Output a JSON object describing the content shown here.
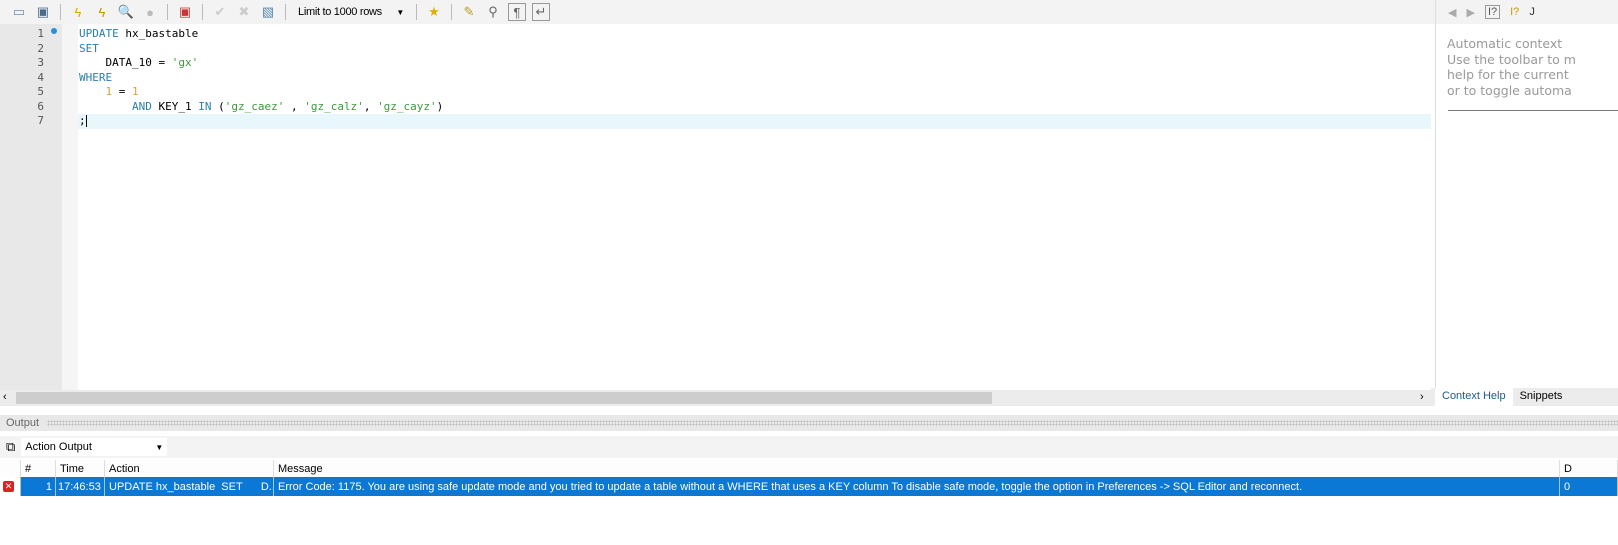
{
  "toolbar": {
    "limit_label": "Limit to 1000 rows",
    "icons": [
      "open-folder-icon",
      "save-icon",
      "execute-icon",
      "execute-current-icon",
      "explain-icon",
      "stop-icon",
      "toggle-error-icon",
      "commit-icon",
      "rollback-icon",
      "autocommit-icon",
      "add-snippet-icon",
      "beautify-icon",
      "find-icon",
      "invisible-chars-icon",
      "wrap-icon"
    ]
  },
  "editor": {
    "line_numbers": [
      "1",
      "2",
      "3",
      "4",
      "5",
      "6",
      "7"
    ],
    "lines": [
      [
        {
          "t": "UPDATE",
          "c": "kw"
        },
        {
          "t": " hx_bastable",
          "c": ""
        }
      ],
      [
        {
          "t": "SET",
          "c": "kw"
        }
      ],
      [
        {
          "t": "    DATA_10 = ",
          "c": ""
        },
        {
          "t": "'gx'",
          "c": "str"
        }
      ],
      [
        {
          "t": "WHERE",
          "c": "kw"
        }
      ],
      [
        {
          "t": "    ",
          "c": ""
        },
        {
          "t": "1",
          "c": "num"
        },
        {
          "t": " = ",
          "c": ""
        },
        {
          "t": "1",
          "c": "num"
        }
      ],
      [
        {
          "t": "        ",
          "c": ""
        },
        {
          "t": "AND",
          "c": "kw"
        },
        {
          "t": " KEY_1 ",
          "c": ""
        },
        {
          "t": "IN",
          "c": "kw"
        },
        {
          "t": " (",
          "c": ""
        },
        {
          "t": "'gz_caez'",
          "c": "str"
        },
        {
          "t": " , ",
          "c": ""
        },
        {
          "t": "'gz_calz'",
          "c": "str"
        },
        {
          "t": ", ",
          "c": ""
        },
        {
          "t": "'gz_cayz'",
          "c": "str"
        },
        {
          "t": ")",
          "c": ""
        }
      ],
      [
        {
          "t": ";",
          "c": ""
        }
      ]
    ]
  },
  "right_panel": {
    "toolbar_extra": "J",
    "help_lines": [
      "Automatic context",
      "Use the toolbar to m",
      "help for the current",
      "or to toggle automa"
    ],
    "tabs": [
      "Context Help",
      "Snippets"
    ]
  },
  "output": {
    "title": "Output",
    "selector": "Action Output",
    "columns": [
      "#",
      "Time",
      "Action",
      "Message",
      "D"
    ],
    "rows": [
      {
        "status": "error",
        "num": "1",
        "time": "17:46:53",
        "action": "UPDATE hx_bastable  SET      D...",
        "message": "Error Code: 1175. You are using safe update mode and you tried to update a table without a WHERE that uses a KEY column To disable safe mode, toggle the option in Preferences -> SQL Editor and reconnect.",
        "duration": "0"
      }
    ]
  }
}
